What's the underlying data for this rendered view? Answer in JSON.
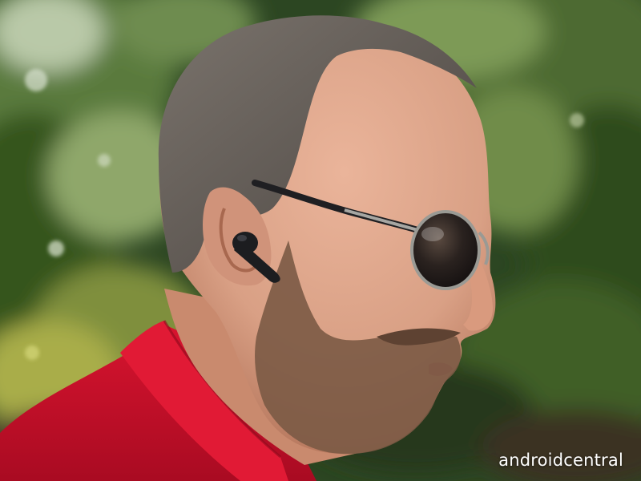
{
  "watermark": {
    "text": "androidcentral"
  },
  "colors": {
    "foliage_dark": "#2a4420",
    "foliage_light": "#6f8a4c",
    "skin": "#e0a98c",
    "skin_shadow": "#b97a60",
    "hair": "#5e5853",
    "beard": "#7a5a44",
    "shirt": "#c8102e",
    "earbud": "#1c1d20",
    "sunglass_lens": "#2b2522",
    "sunglass_frame": "#8a8a86",
    "watermark": "#ffffff"
  },
  "subject": {
    "wearing": [
      "earbud-icon",
      "sunglasses-icon"
    ]
  }
}
